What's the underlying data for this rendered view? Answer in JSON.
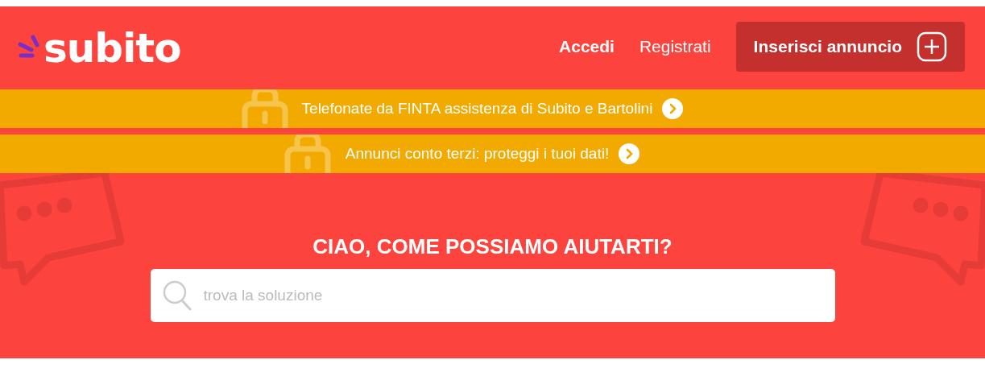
{
  "header": {
    "logo": "subito",
    "links": [
      {
        "label": "Accedi",
        "bold": true
      },
      {
        "label": "Registrati",
        "bold": false
      }
    ],
    "cta": {
      "label": "Inserisci annuncio"
    }
  },
  "banners": [
    {
      "text": "Telefonate da FINTA assistenza di Subito e Bartolini"
    },
    {
      "text": "Annunci conto terzi: proteggi i tuoi dati!"
    }
  ],
  "hero": {
    "title": "CIAO, COME POSSIAMO AIUTARTI?",
    "search": {
      "placeholder": "trova la soluzione"
    }
  }
}
